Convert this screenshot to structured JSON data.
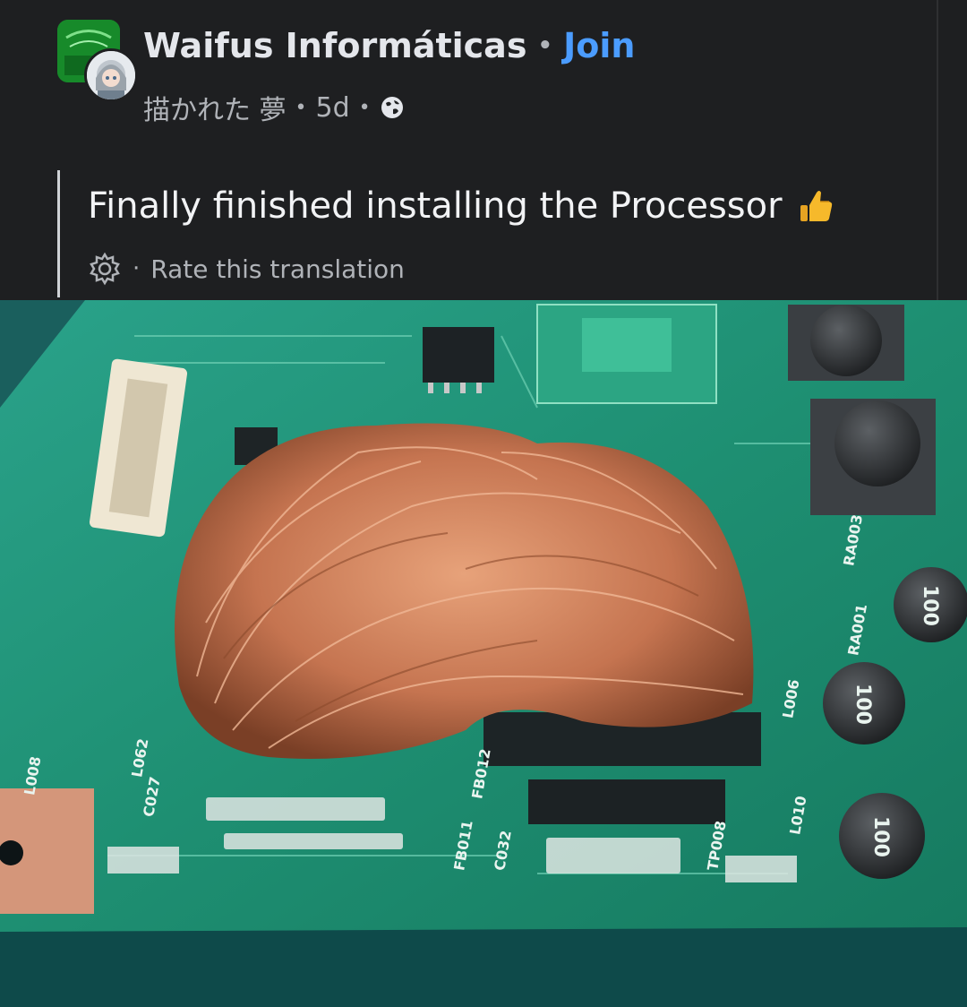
{
  "post": {
    "group_name": "Waifus Informáticas",
    "separator": "•",
    "join_label": "Join",
    "author": "描かれた 夢",
    "time": "5d",
    "text": "Finally finished installing the Processor",
    "rate_translation": "Rate this translation"
  },
  "image_labels": {
    "inductor_a": "100",
    "inductor_b": "100",
    "inductor_c": "100",
    "board_1": "L008",
    "board_2": "L062",
    "board_3": "FB012",
    "board_4": "FB011",
    "board_5": "C032",
    "board_6": "L006",
    "board_7": "L010",
    "board_8": "RA003",
    "board_9": "RA001",
    "board_10": "C027",
    "board_11": "TP008"
  },
  "colors": {
    "background": "#1e1f21",
    "link": "#4b9cff",
    "pcb": "#1f8f76",
    "copper": "#c97a52"
  },
  "icons": {
    "globe": "globe-icon",
    "thumb": "thumbs-up-icon",
    "gear": "gear-icon"
  }
}
